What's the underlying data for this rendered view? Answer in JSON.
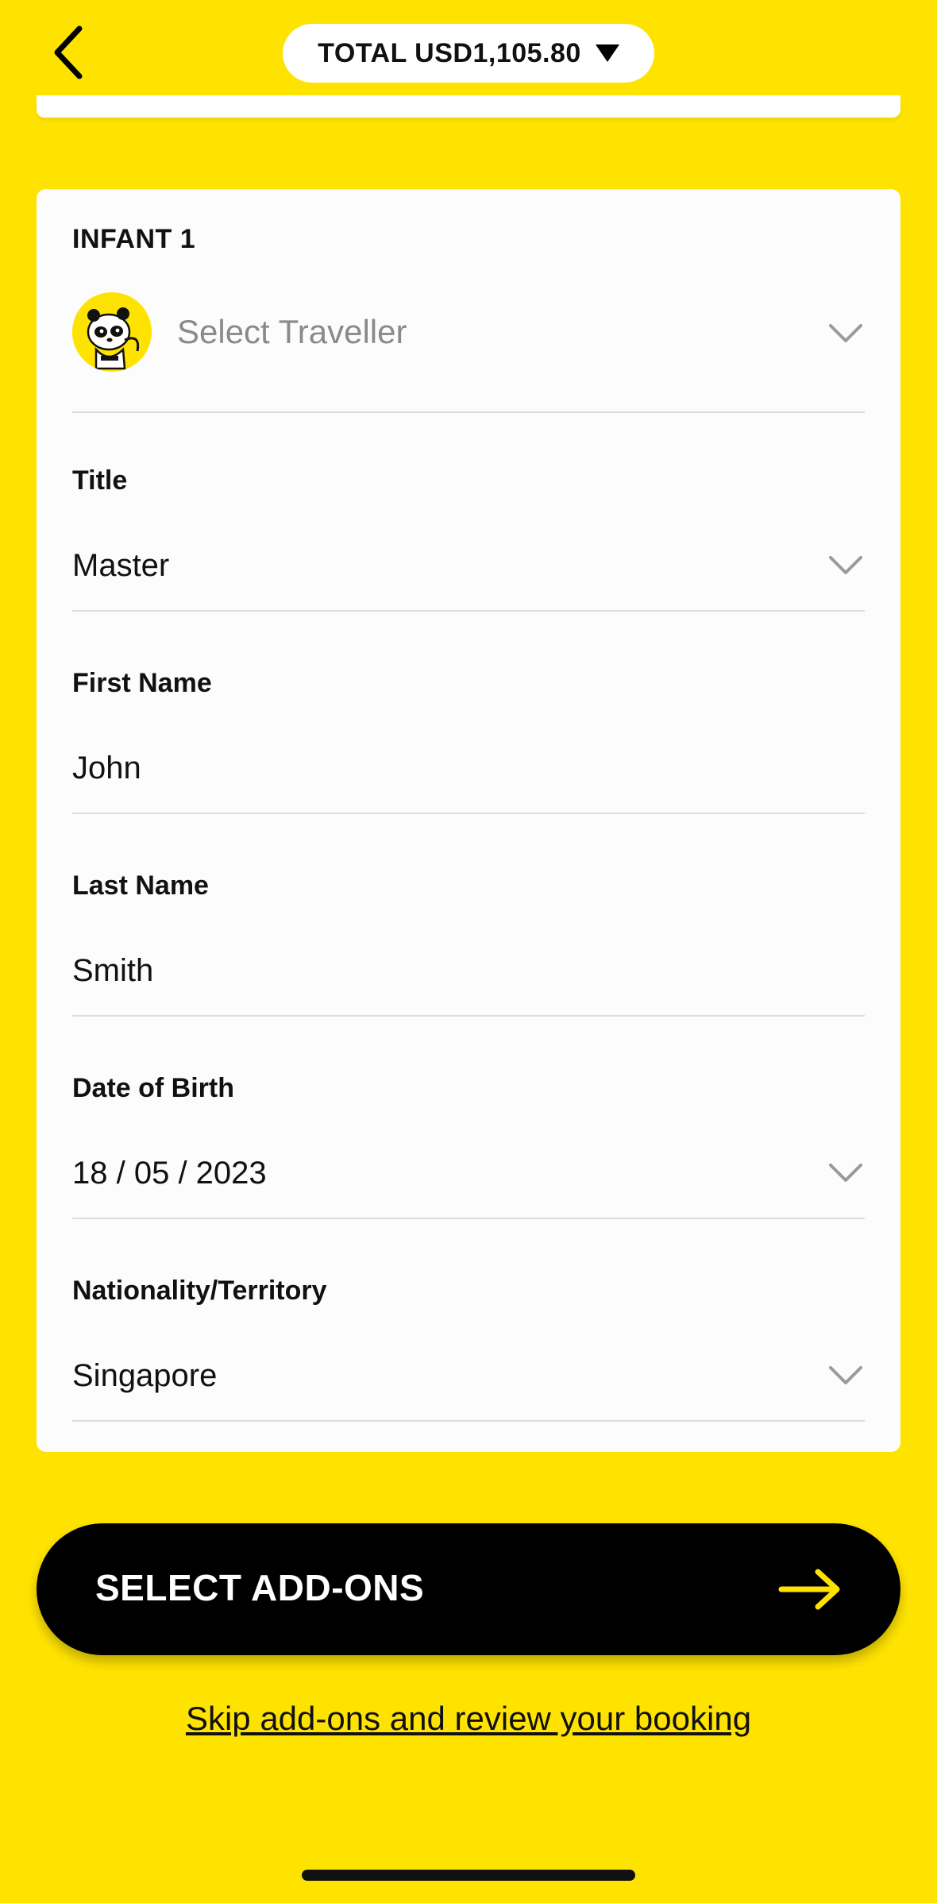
{
  "header": {
    "total_label": "TOTAL USD1,105.80"
  },
  "infant_card": {
    "title": "INFANT 1",
    "traveller_placeholder": "Select Traveller",
    "fields": {
      "title": {
        "label": "Title",
        "value": "Master"
      },
      "first_name": {
        "label": "First Name",
        "value": "John"
      },
      "last_name": {
        "label": "Last Name",
        "value": "Smith"
      },
      "dob": {
        "label": "Date of Birth",
        "value": "18 / 05 / 2023"
      },
      "nationality": {
        "label": "Nationality/Territory",
        "value": "Singapore"
      }
    }
  },
  "cta": {
    "label": "SELECT ADD-ONS"
  },
  "skip_link": "Skip add-ons and review your booking",
  "colors": {
    "brand_yellow": "#FFE300",
    "cta_black": "#000000",
    "arrow_yellow": "#FFE300"
  },
  "icons": [
    "back-chevron-icon",
    "caret-down-icon",
    "panda-mascot-icon",
    "chevron-down-icon",
    "arrow-right-icon"
  ]
}
